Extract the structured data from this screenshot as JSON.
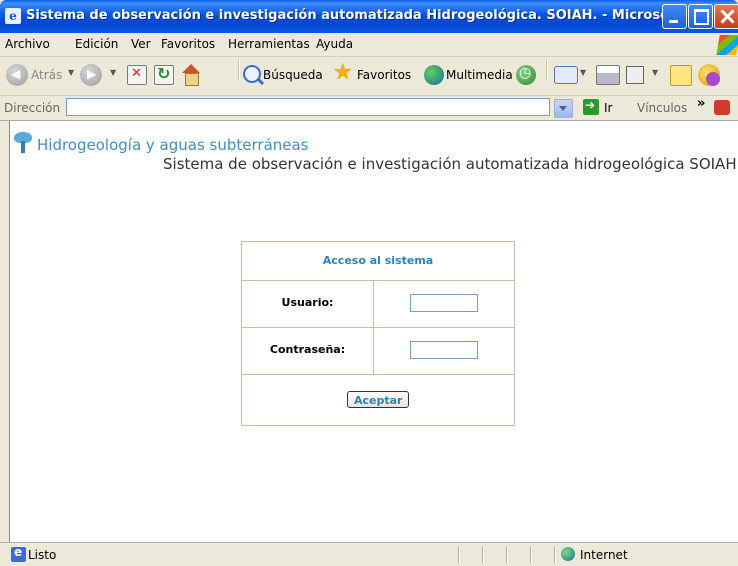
{
  "window": {
    "title": "Sistema de observación e investigación automatizada Hidrogeológica. SOIAH. - Microso..."
  },
  "menu": [
    "Archivo",
    "Edición",
    "Ver",
    "Favoritos",
    "Herramientas",
    "Ayuda"
  ],
  "toolbar": {
    "back_label": "Atrás",
    "search_label": "Búsqueda",
    "favorites_label": "Favoritos",
    "media_label": "Multimedia"
  },
  "address": {
    "label": "Dirección",
    "value": "",
    "go_label": "Ir",
    "links_label": "Vínculos",
    "links_chevron": "»"
  },
  "page": {
    "site_title": "Hidrogeología y aguas subterráneas",
    "system_title": "Sistema de observación e investigación automatizada hidrogeológica SOIAH",
    "login": {
      "title": "Acceso al sistema",
      "user_label": "Usuario:",
      "user_value": "",
      "password_label": "Contraseña:",
      "password_value": "",
      "submit_label": "Aceptar"
    }
  },
  "status": {
    "text": "Listo",
    "zone": "Internet"
  }
}
